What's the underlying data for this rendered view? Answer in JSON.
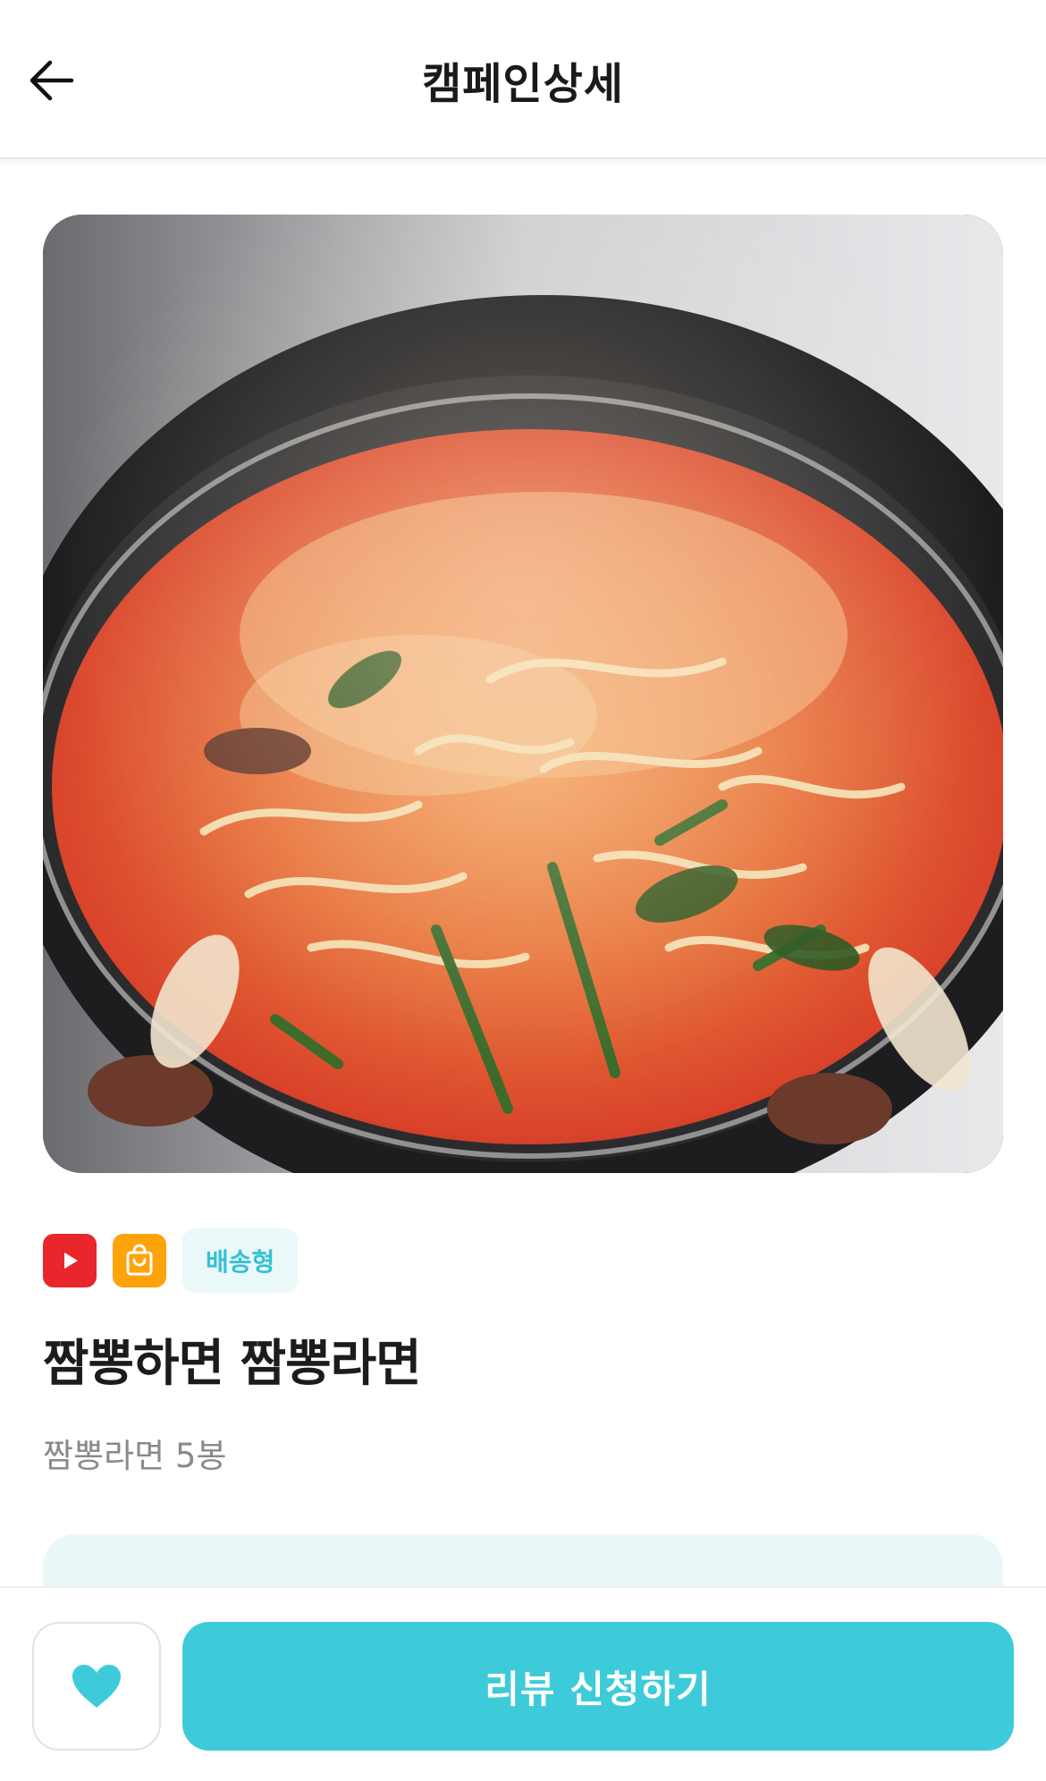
{
  "header": {
    "title": "캠페인상세",
    "back_icon": "arrow-left-icon"
  },
  "campaign": {
    "image_alt": "짬뽕라면 조리 사진",
    "badges": {
      "platform_icon": "youtube-icon",
      "shop_icon": "shopping-bag-icon",
      "type_label": "배송형"
    },
    "title": "짬뽕하면 짬뽕라면",
    "subtitle": "짬뽕라면 5봉"
  },
  "bottom_bar": {
    "like_icon": "heart-icon",
    "apply_label": "리뷰 신청하기"
  },
  "colors": {
    "accent": "#3ECBD9",
    "youtube": "#E8262B",
    "shop": "#FFA30B",
    "type_badge_bg": "#EAF8FA",
    "type_badge_text": "#33C2D3"
  }
}
